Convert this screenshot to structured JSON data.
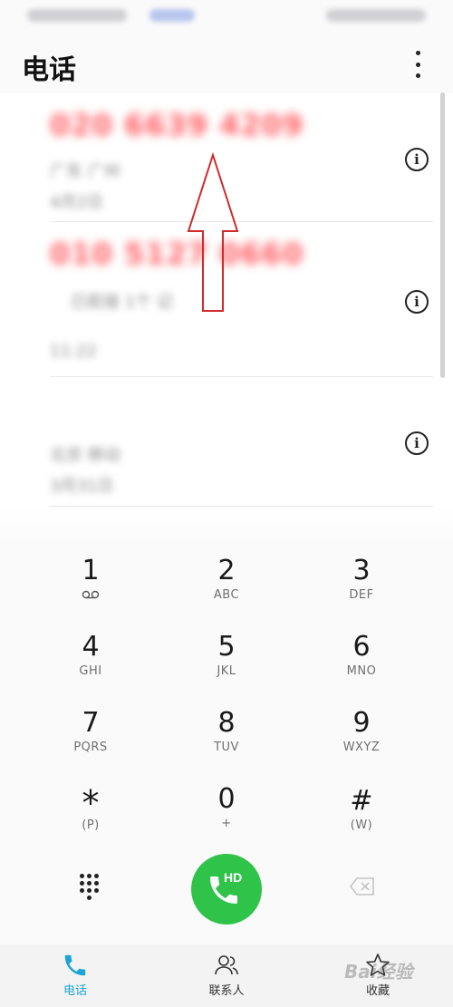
{
  "app": {
    "title": "电话"
  },
  "recent_calls": [
    {
      "number": "020 6639 4209",
      "line2": "广东 广州",
      "line3": "4月2日"
    },
    {
      "number": "010 5127 0660",
      "line2": "已拒接 1个 记",
      "line3": "11:22"
    },
    {
      "number": "",
      "line2": "北京 移动",
      "line3": "3月31日"
    }
  ],
  "dialpad": {
    "keys": [
      {
        "digit": "1",
        "sub": ""
      },
      {
        "digit": "2",
        "sub": "ABC"
      },
      {
        "digit": "3",
        "sub": "DEF"
      },
      {
        "digit": "4",
        "sub": "GHI"
      },
      {
        "digit": "5",
        "sub": "JKL"
      },
      {
        "digit": "6",
        "sub": "MNO"
      },
      {
        "digit": "7",
        "sub": "PQRS"
      },
      {
        "digit": "8",
        "sub": "TUV"
      },
      {
        "digit": "9",
        "sub": "WXYZ"
      },
      {
        "digit": "*",
        "sub": "(P)"
      },
      {
        "digit": "0",
        "sub": "+"
      },
      {
        "digit": "#",
        "sub": "(W)"
      }
    ]
  },
  "call_button": {
    "label": "HD",
    "color": "#2fc34a"
  },
  "tabs": [
    {
      "label": "电话",
      "active": true,
      "color": "#1aa5d4"
    },
    {
      "label": "联系人",
      "active": false,
      "color": "#333333"
    },
    {
      "label": "收藏",
      "active": false,
      "color": "#333333"
    }
  ],
  "watermark": {
    "text": "Bai经验"
  },
  "icons": {
    "menu": "more-vert-icon",
    "info": "info-icon",
    "voicemail": "voicemail-icon",
    "dialpad_toggle": "dialpad-grid-icon",
    "call": "phone-icon",
    "backspace": "backspace-icon",
    "arrow": "up-arrow-icon"
  }
}
